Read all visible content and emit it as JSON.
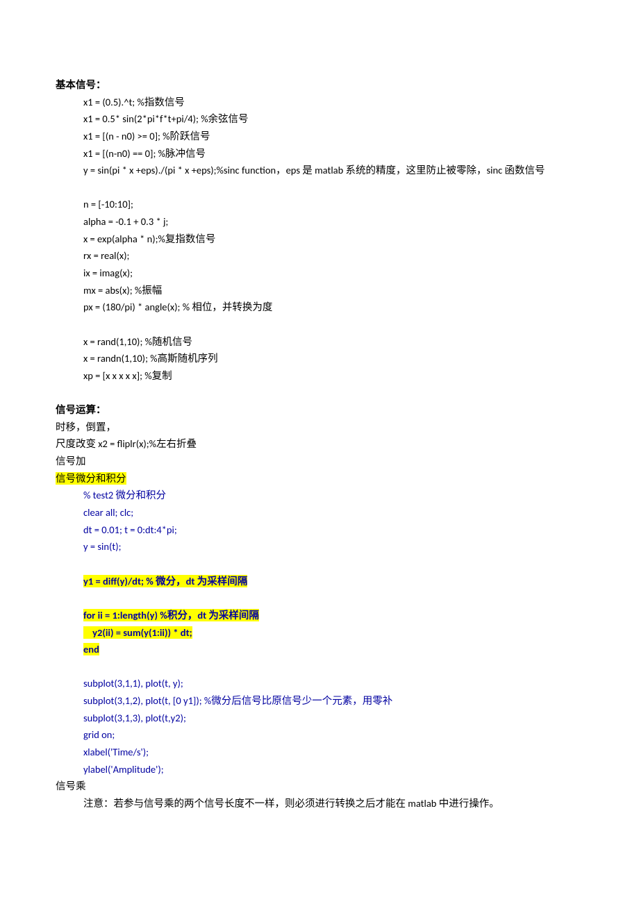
{
  "h1": "基本信号：",
  "s1": [
    "x1 = (0.5).^t; %指数信号",
    "x1 = 0.5* sin(2*pi*f*t+pi/4); %余弦信号",
    "x1 = [(n - n0) >= 0]; %阶跃信号",
    "x1 = [(n-n0) == 0]; %脉冲信号",
    "y = sin(pi * x +eps)./(pi * x +eps);%sinc function，eps 是 matlab 系统的精度，这里防止被零除，sinc 函数信号"
  ],
  "s2": [
    "n = [-10:10];",
    "alpha = -0.1 + 0.3 * j;",
    "x = exp(alpha * n);%复指数信号",
    "rx = real(x);",
    "ix = imag(x);",
    "mx = abs(x); %振幅",
    "px = (180/pi) * angle(x); %  相位，并转换为度"
  ],
  "s3": [
    "x = rand(1,10); %随机信号",
    "x = randn(1,10); %高斯随机序列",
    "xp = [x x x x x]; %复制"
  ],
  "h2": "信号运算：",
  "p1": "时移，倒置，",
  "p2": "尺度改变 x2 = fliplr(x);%左右折叠",
  "p3": "信号加",
  "p4": "信号微分和积分",
  "s4": [
    "% test2  微分和积分",
    "clear all; clc;",
    "dt = 0.01; t = 0:dt:4*pi;",
    "y = sin(t);"
  ],
  "s5": [
    "y1 = diff(y)/dt; %  微分，dt 为采样间隔"
  ],
  "s6": [
    "for ii = 1:length(y) %积分，dt 为采样间隔",
    "    y2(ii) = sum(y(1:ii)) * dt;",
    "end"
  ],
  "s7": [
    "subplot(3,1,1), plot(t, y);",
    "subplot(3,1,2), plot(t, [0 y1]);    %微分后信号比原信号少一个元素，用零补",
    "subplot(3,1,3), plot(t,y2);",
    "grid on;",
    "xlabel('Time/s');",
    "ylabel('Amplitude');"
  ],
  "p5": "信号乘",
  "p6": "注意：若参与信号乘的两个信号长度不一样，则必须进行转换之后才能在 matlab 中进行操作。"
}
